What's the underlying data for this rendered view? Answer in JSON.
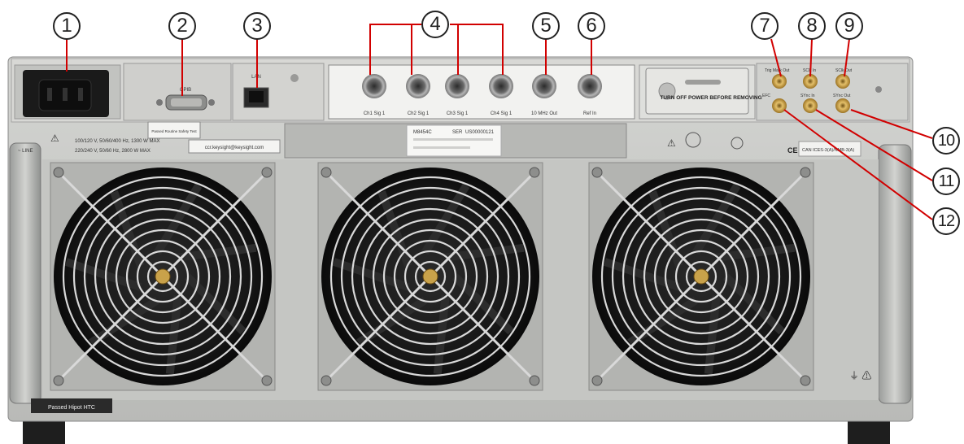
{
  "callouts": [
    "1",
    "2",
    "3",
    "4",
    "5",
    "6",
    "7",
    "8",
    "9",
    "10",
    "11",
    "12"
  ],
  "top_labels": {
    "gpib": "GPIB",
    "lan": "LAN",
    "ch1": "Ch1 Sig 1",
    "ch2": "Ch2 Sig 1",
    "ch3": "Ch3 Sig 1",
    "ch4": "Ch4 Sig 1",
    "out10": "10 MHz Out",
    "refin": "Ref In"
  },
  "stickers": {
    "safety": "Passed Routine Safety Test",
    "url": "ccr.keysight@keysight.com",
    "warning": "TURN OFF POWER BEFORE REMOVING",
    "hipot": "Passed Hipot HTC",
    "model": "M8454C",
    "serial_prefix": "SER",
    "serial": "US00000121",
    "ce": "CE",
    "can": "CAN ICES-3(A)/NMB-3(A)"
  },
  "power_lines": {
    "line1": "100/120 V, 50/60/400 Hz, 1300 W MAX",
    "line2_prefix": "~ LINE",
    "line2": "220/240 V, 50/60 Hz, 2800 W MAX"
  },
  "smb_labels": {
    "trig_out": "Trig Mark Out",
    "sclk_in": "SClk In",
    "sclk_out": "SClk Out",
    "efc": "EFC",
    "sync_in": "SYnc In",
    "sync_out": "SYnc Out"
  },
  "colors": {
    "panel": "#c7c8c6",
    "upper_panel": "#d9d9d6",
    "fan_black": "#1c1c1c",
    "grille": "#d8d8d8",
    "gold": "#c9a24a",
    "leader": "#d10000"
  }
}
